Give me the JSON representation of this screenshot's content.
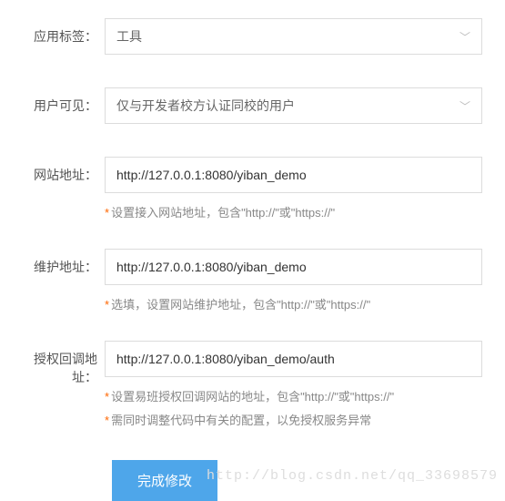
{
  "fields": {
    "app_tag": {
      "label": "应用标签：",
      "value": "工具"
    },
    "user_visible": {
      "label": "用户可见：",
      "value": "仅与开发者校方认证同校的用户"
    },
    "site_url": {
      "label": "网站地址：",
      "value": "http://127.0.0.1:8080/yiban_demo",
      "hint": "设置接入网站地址，包含\"http://\"或\"https://\""
    },
    "maintain_url": {
      "label": "维护地址：",
      "value": "http://127.0.0.1:8080/yiban_demo",
      "hint": "选填，设置网站维护地址，包含\"http://\"或\"https://\""
    },
    "callback_url": {
      "label": "授权回调地址：",
      "value": "http://127.0.0.1:8080/yiban_demo/auth",
      "hint1": "设置易班授权回调网站的地址，包含\"http://\"或\"https://\"",
      "hint2": "需同时调整代码中有关的配置，以免授权服务异常"
    }
  },
  "submit_label": "完成修改",
  "watermark": "http://blog.csdn.net/qq_33698579"
}
